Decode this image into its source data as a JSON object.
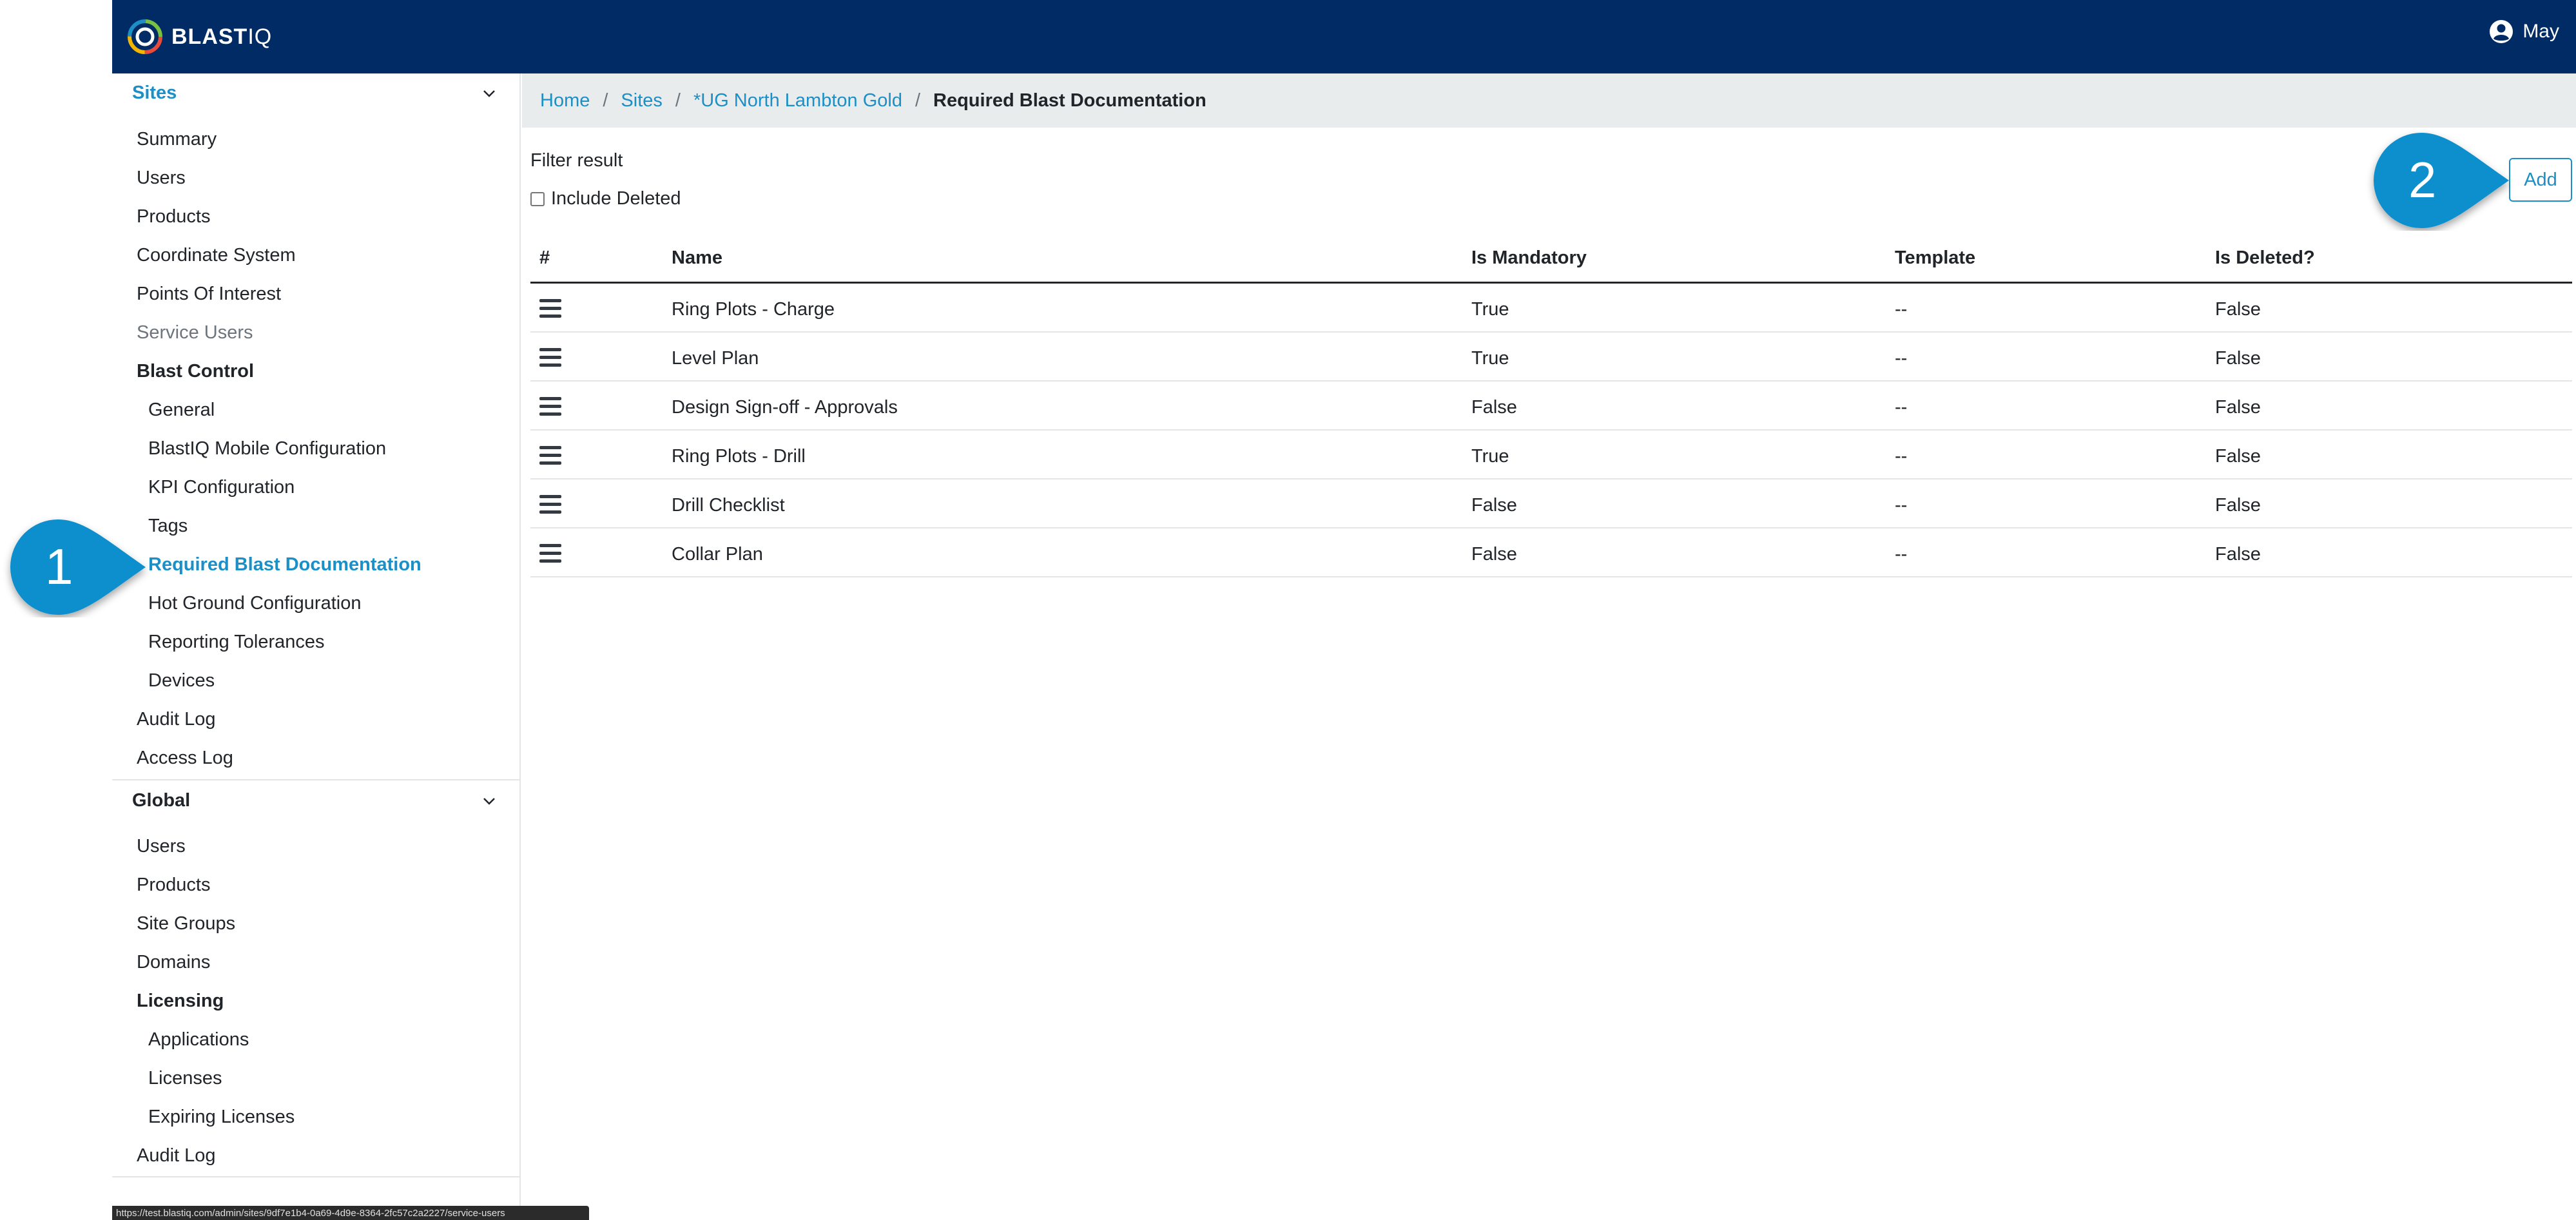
{
  "brand": {
    "name_bold": "BLAST",
    "name_light": "IQ"
  },
  "user": {
    "name": "May"
  },
  "sidebar": {
    "sites": {
      "header": "Sites",
      "items": [
        "Summary",
        "Users",
        "Products",
        "Coordinate System",
        "Points Of Interest",
        "Service Users"
      ],
      "blast_control": {
        "header": "Blast Control",
        "items": [
          "General",
          "BlastIQ Mobile Configuration",
          "KPI Configuration",
          "Tags",
          "Required Blast Documentation",
          "Hot Ground Configuration",
          "Reporting Tolerances",
          "Devices"
        ]
      },
      "after_items": [
        "Audit Log",
        "Access Log"
      ]
    },
    "global": {
      "header": "Global",
      "items": [
        "Users",
        "Products",
        "Site Groups",
        "Domains"
      ],
      "licensing": {
        "header": "Licensing",
        "items": [
          "Applications",
          "Licenses",
          "Expiring Licenses"
        ]
      },
      "after_items": [
        "Audit Log"
      ]
    }
  },
  "breadcrumb": [
    "Home",
    "Sites",
    "*UG North Lambton Gold",
    "Required Blast Documentation"
  ],
  "filter": {
    "title": "Filter result",
    "include_deleted_label": "Include Deleted",
    "include_deleted_checked": false
  },
  "add_button": "Add",
  "table": {
    "headers": [
      "#",
      "Name",
      "Is Mandatory",
      "Template",
      "Is Deleted?"
    ],
    "rows": [
      [
        "Ring Plots - Charge",
        "True",
        "--",
        "False"
      ],
      [
        "Level Plan",
        "True",
        "--",
        "False"
      ],
      [
        "Design Sign-off - Approvals",
        "False",
        "--",
        "False"
      ],
      [
        "Ring Plots - Drill",
        "True",
        "--",
        "False"
      ],
      [
        "Drill Checklist",
        "False",
        "--",
        "False"
      ],
      [
        "Collar Plan",
        "False",
        "--",
        "False"
      ]
    ]
  },
  "callouts": [
    "1",
    "2"
  ],
  "status_url": "https://test.blastiq.com/admin/sites/9df7e1b4-0a69-4d9e-8364-2fc57c2a2227/service-users",
  "colors": {
    "navbar": "#002b64",
    "accent": "#1b8fc6",
    "callout": "#0c8fce"
  }
}
